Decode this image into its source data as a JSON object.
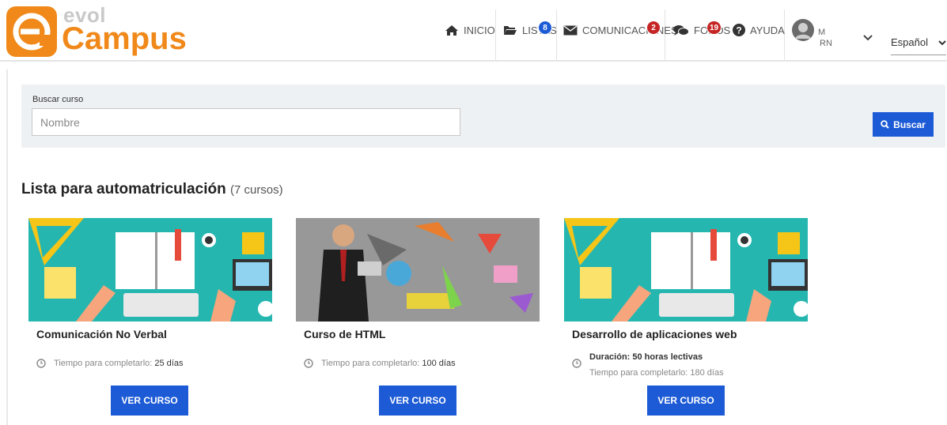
{
  "logo": {
    "line1": "evol",
    "line2": "Campus"
  },
  "nav": {
    "inicio": "INICIO",
    "listas": "LISTAS",
    "listas_badge": "8",
    "comunicaciones": "COMUNICACIONES",
    "comunicaciones_badge": "2",
    "foros": "FOROS",
    "foros_badge": "19",
    "ayuda": "AYUDA",
    "user_line1": "M",
    "user_line2": "RN",
    "language": "Español"
  },
  "search": {
    "label": "Buscar curso",
    "placeholder": "Nombre",
    "button": "Buscar"
  },
  "section": {
    "title": "Lista para automatriculación",
    "count": "(7 cursos)"
  },
  "courses": [
    {
      "title": "Comunicación No Verbal",
      "time_label": "Tiempo para completarlo:",
      "time_value": "25 días",
      "button": "VER CURSO"
    },
    {
      "title": "Curso de HTML",
      "time_label": "Tiempo para completarlo:",
      "time_value": "100 días",
      "button": "VER CURSO"
    },
    {
      "title": "Desarrollo de aplicaciones web",
      "duration": "Duración: 50 horas lectivas",
      "time_label": "Tiempo para completarlo:",
      "time_value": "180 días",
      "button": "VER CURSO"
    }
  ],
  "colors": {
    "accent": "#1d5bd6",
    "badge_red": "#c62525",
    "brand_orange": "#f0891a",
    "teal": "#26b6b0"
  }
}
